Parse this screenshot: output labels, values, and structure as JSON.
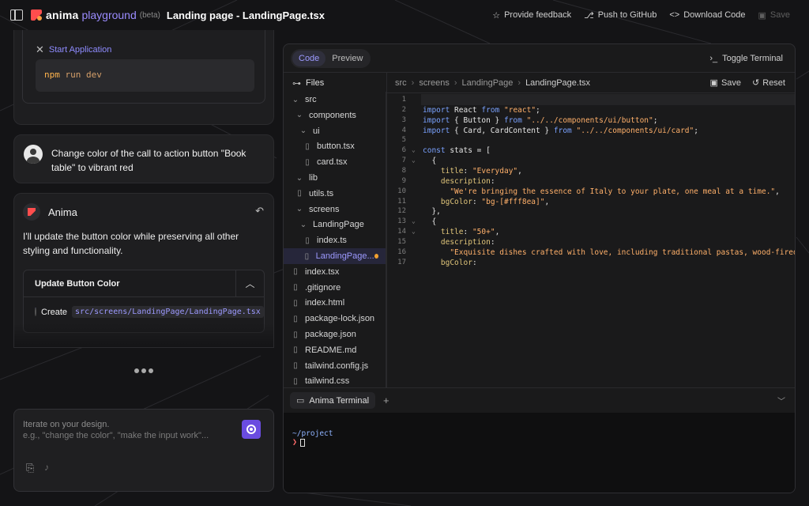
{
  "header": {
    "brand": "anima",
    "brand_sub": "playground",
    "beta": "(beta)",
    "title": "Landing page - LandingPage.tsx",
    "actions": {
      "feedback": "Provide feedback",
      "github": "Push to GitHub",
      "download": "Download Code",
      "save": "Save"
    }
  },
  "chat": {
    "start_app_label": "Start Application",
    "command_bin": "npm",
    "command_args": "run dev",
    "user_message": "Change color of the call to action button \"Book table\" to vibrant red",
    "assistant_name": "Anima",
    "assistant_message": "I'll update the button color while preserving all other styling and functionality.",
    "task_title": "Update Button Color",
    "task_action": "Create",
    "task_path": "src/screens/LandingPage/LandingPage.tsx",
    "input_placeholder_1": "Iterate on your design.",
    "input_placeholder_2": "e.g., \"change the color\", \"make the input work\"..."
  },
  "editor": {
    "tabs": [
      "Code",
      "Preview"
    ],
    "active_tab": "Code",
    "toggle_terminal": "Toggle Terminal",
    "files_label": "Files",
    "breadcrumb": [
      "src",
      "screens",
      "LandingPage",
      "LandingPage.tsx"
    ],
    "save_label": "Save",
    "reset_label": "Reset",
    "tree": [
      {
        "name": "src",
        "type": "folder"
      },
      {
        "name": "components",
        "type": "folder"
      },
      {
        "name": "ui",
        "type": "folder"
      },
      {
        "name": "button.tsx",
        "type": "file"
      },
      {
        "name": "card.tsx",
        "type": "file"
      },
      {
        "name": "lib",
        "type": "folder"
      },
      {
        "name": "utils.ts",
        "type": "file"
      },
      {
        "name": "screens",
        "type": "folder"
      },
      {
        "name": "LandingPage",
        "type": "folder"
      },
      {
        "name": "index.ts",
        "type": "file"
      },
      {
        "name": "LandingPage...",
        "type": "file",
        "selected": true,
        "modified": true
      },
      {
        "name": "index.tsx",
        "type": "file"
      },
      {
        "name": ".gitignore",
        "type": "file"
      },
      {
        "name": "index.html",
        "type": "file"
      },
      {
        "name": "package-lock.json",
        "type": "file"
      },
      {
        "name": "package.json",
        "type": "file"
      },
      {
        "name": "README.md",
        "type": "file"
      },
      {
        "name": "tailwind.config.js",
        "type": "file"
      },
      {
        "name": "tailwind.css",
        "type": "file"
      }
    ],
    "code_lines": [
      "",
      "import React from \"react\";",
      "import { Button } from \"../../components/ui/button\";",
      "import { Card, CardContent } from \"../../components/ui/card\";",
      "",
      "const stats = [",
      "  {",
      "    title: \"Everyday\",",
      "    description:",
      "      \"We're bringing the essence of Italy to your plate, one meal at a time.\",",
      "    bgColor: \"bg-[#fff8ea]\",",
      "  },",
      "  {",
      "    title: \"50+\",",
      "    description:",
      "      \"Exquisite dishes crafted with love, including traditional pastas, wood-fired pizzas,",
      "    bgColor:"
    ],
    "terminal_tab": "Anima Terminal",
    "terminal_cwd": "~/project",
    "terminal_prompt": "❯"
  }
}
